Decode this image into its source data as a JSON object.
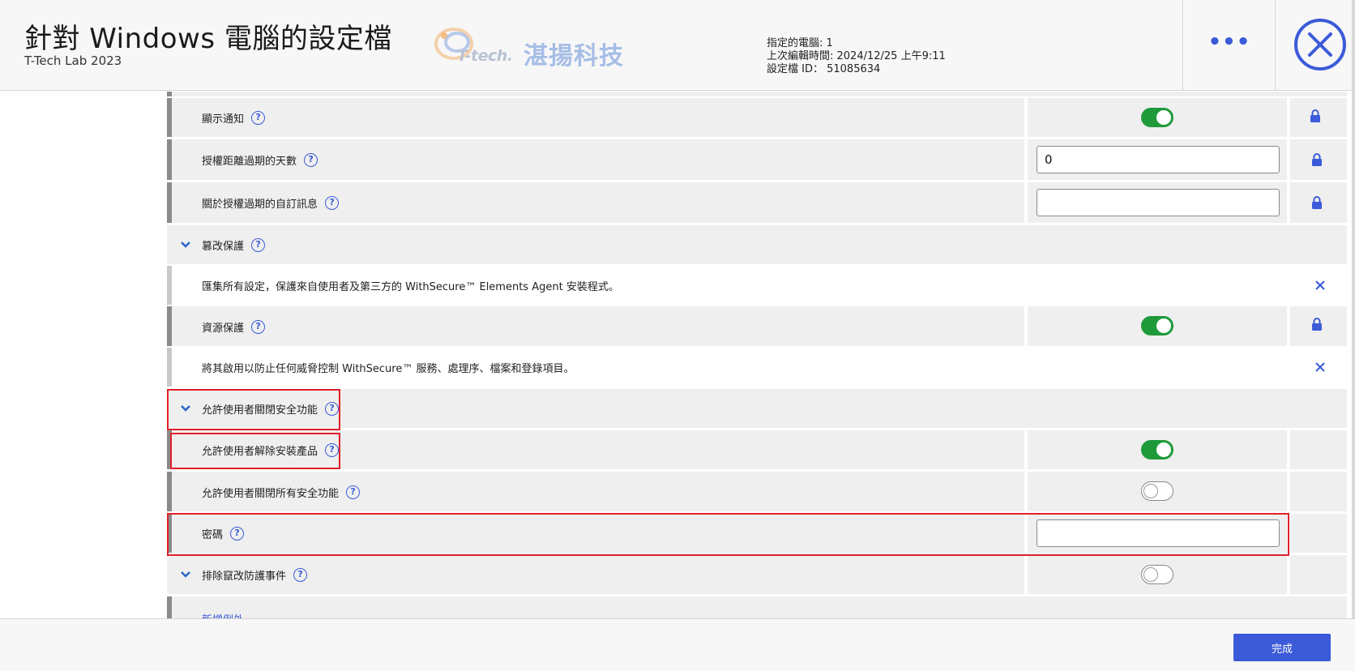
{
  "header": {
    "title": "針對 Windows 電腦的設定檔",
    "subtitle": "T-Tech Lab 2023",
    "logo": {
      "tech": "T-tech.",
      "cn": "湛揚科技"
    },
    "meta": {
      "assigned": "指定的電腦: 1",
      "last_edit": "上次編輯時間: 2024/12/25 上午9:11",
      "profile_id": "設定檔 ID： 51085634"
    },
    "more_label": "•••"
  },
  "rows": {
    "show_notification": {
      "label": "顯示通知"
    },
    "license_days": {
      "label": "授權距離過期的天數",
      "value": "0"
    },
    "license_msg": {
      "label": "關於授權過期的自訂訊息",
      "value": ""
    },
    "tamper": {
      "label": "篡改保護"
    },
    "tamper_desc": {
      "label": "匯集所有設定，保護來自使用者及第三方的 WithSecure™ Elements Agent 安裝程式。"
    },
    "resource": {
      "label": "資源保護"
    },
    "resource_desc": {
      "label": "將其啟用以防止任何威脅控制 WithSecure™ 服務、處理序、檔案和登錄項目。"
    },
    "allow_disable": {
      "label": "允許使用者關閉安全功能"
    },
    "allow_uninstall": {
      "label": "允許使用者解除安裝產品"
    },
    "allow_disable_all": {
      "label": "允許使用者關閉所有安全功能"
    },
    "password": {
      "label": "密碼",
      "value": ""
    },
    "exclude_tamper": {
      "label": "排除竄改防護事件"
    },
    "add_exception": {
      "label": "新增例外"
    }
  },
  "help_glyph": "?",
  "footer": {
    "done_label": "完成"
  },
  "colors": {
    "accent": "#3b5bd8",
    "toggle_on": "#1f9a3a",
    "highlight": "#e0202a"
  }
}
